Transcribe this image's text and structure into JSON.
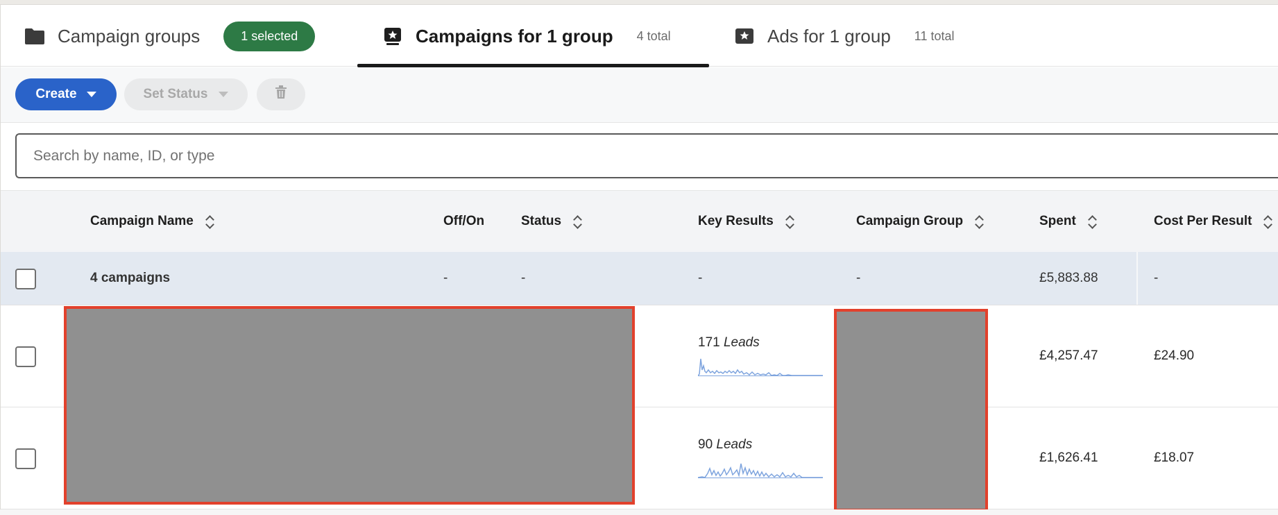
{
  "tabs": {
    "campaign_groups": {
      "label": "Campaign groups",
      "badge": "1 selected"
    },
    "campaigns": {
      "label": "Campaigns for 1 group",
      "count": "4 total"
    },
    "ads": {
      "label": "Ads for 1 group",
      "count": "11 total"
    }
  },
  "toolbar": {
    "create_label": "Create",
    "set_status_label": "Set Status"
  },
  "search": {
    "placeholder": "Search by name, ID, or type"
  },
  "table": {
    "columns": {
      "name": "Campaign Name",
      "offon": "Off/On",
      "status": "Status",
      "key_results": "Key Results",
      "campaign_group": "Campaign Group",
      "spent": "Spent",
      "cpr": "Cost Per Result"
    },
    "summary": {
      "name": "4 campaigns",
      "offon": "-",
      "status": "-",
      "key_results": "-",
      "campaign_group": "-",
      "spent": "£5,883.88",
      "cpr": "-"
    },
    "rows": [
      {
        "key_results_value": "171",
        "key_results_unit": "Leads",
        "spent": "£4,257.47",
        "cpr": "£24.90"
      },
      {
        "key_results_value": "90",
        "key_results_unit": "Leads",
        "spent": "£1,626.41",
        "cpr": "£18.07"
      }
    ]
  },
  "colors": {
    "primary_button": "#2a63c9",
    "selected_badge": "#2d7a45",
    "sparkline": "#7ea4de",
    "redaction_border": "#e2412c"
  },
  "icons": {
    "campaign_groups": "folder-icon",
    "campaigns": "campaign-star-icon",
    "ads": "ad-star-icon",
    "delete": "trash-icon"
  }
}
